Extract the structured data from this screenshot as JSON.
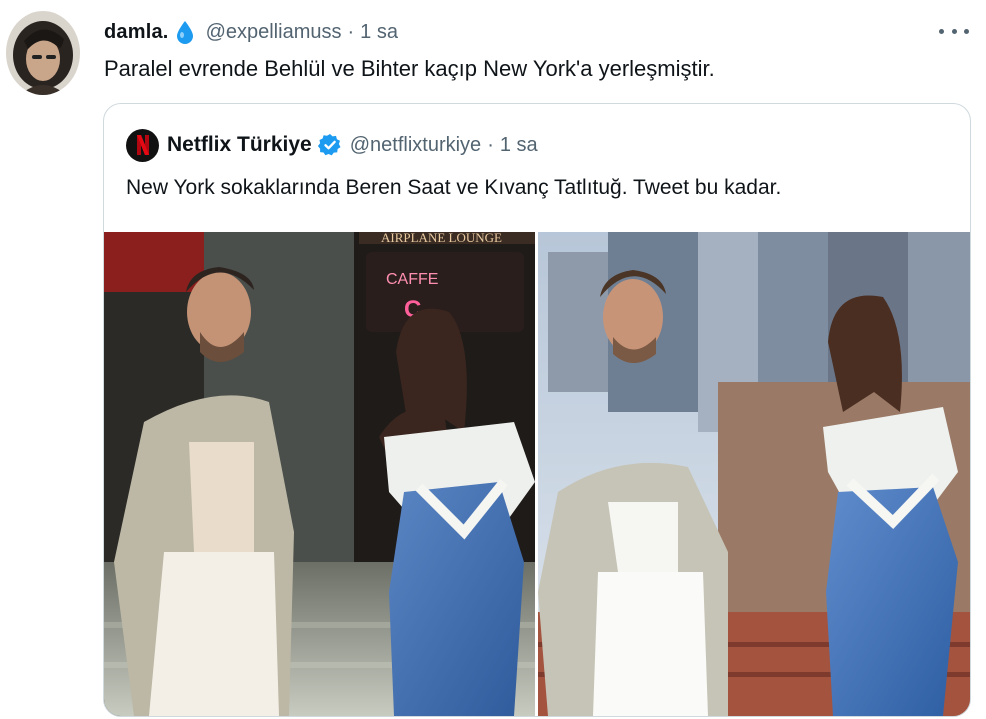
{
  "tweet": {
    "author": {
      "display_name": "damla.",
      "handle": "@expelliamuss",
      "badge_icon": "water-drop-icon",
      "badge_color": "#1d9bf0"
    },
    "separator": "·",
    "time": "1 sa",
    "text": "Paralel evrende Behlül ve Bihter kaçıp New York'a yerleşmiştir.",
    "more_icon": "more-horizontal-icon"
  },
  "quoted_tweet": {
    "author": {
      "display_name": "Netflix Türkiye",
      "handle": "@netflixturkiye",
      "logo_letter": "N",
      "logo_color": "#e50914",
      "verified_icon": "verified-badge-icon",
      "verified_color": "#1d9bf0"
    },
    "separator": "·",
    "time": "1 sa",
    "text": "New York sokaklarında Beren Saat ve Kıvanç Tatlıtuğ. Tweet bu kadar.",
    "photos": [
      {
        "scene": "street-cafe",
        "neon_sign": "CAFFE"
      },
      {
        "scene": "rooftop-city"
      }
    ]
  }
}
